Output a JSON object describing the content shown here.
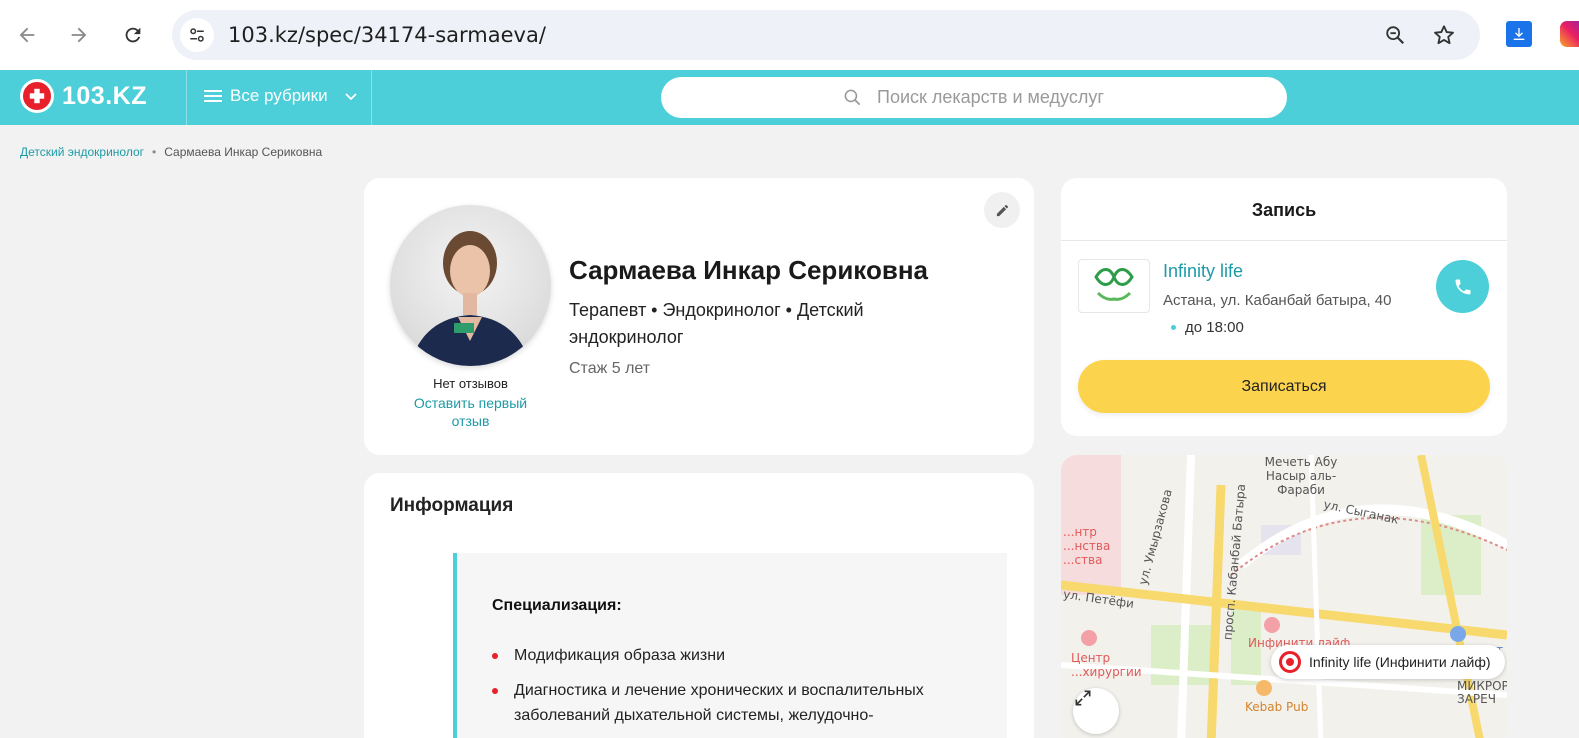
{
  "browser": {
    "url": "103.kz/spec/34174-sarmaeva/",
    "icons": [
      "back-icon",
      "forward-icon",
      "reload-icon",
      "site-info-icon",
      "zoom-icon",
      "star-icon",
      "download-extension-icon",
      "instagram-extension-icon"
    ]
  },
  "header": {
    "logo_text": "103.KZ",
    "rubrics_label": "Все рубрики",
    "search_placeholder": "Поиск лекарств и медуслуг",
    "brand_color": "#4ccfd9",
    "logo_color": "#e8202a"
  },
  "breadcrumb": {
    "parent": "Детский эндокринолог",
    "separator": "•",
    "current": "Сармаева Инкар Сериковна"
  },
  "profile": {
    "name": "Сармаева Инкар Сериковна",
    "specialties": "Терапевт • Эндокринолог • Детский эндокринолог",
    "experience": "Стаж 5 лет",
    "reviews_status": "Нет отзывов",
    "first_review_link": "Оставить первый отзыв"
  },
  "info": {
    "title": "Информация",
    "specialization_label": "Специализация:",
    "items": [
      "Модификация образа жизни",
      "Диагностика и лечение хронических и воспалительных заболеваний дыхательной системы, желудочно-"
    ]
  },
  "booking": {
    "title": "Запись",
    "clinic_name": "Infinity life",
    "clinic_address": "Астана, ул. Кабанбай батыра, 40",
    "hours": "до 18:00",
    "book_button": "Записаться",
    "button_color": "#fcd34d"
  },
  "map": {
    "pin_label": "Infinity life (Инфинити лайф)",
    "labels": {
      "mosque": "Мечеть Абу Насыр аль-Фараби",
      "street_syganak": "ул. Сыганак",
      "street_umyrzakov": "ул. Умырзакова",
      "street_kabanbay": "просп. Кабанбай Батыра",
      "street_petofi": "ул. Петёфи",
      "infiniti": "Инфинити лайф",
      "center_surgery": "Центр ...хирургии",
      "center_left": "...нтр ...нства ...ства",
      "kebab": "Kebab Pub",
      "komfort": "Комфорт",
      "mikror": "МИКРОР ЗАРЕЧ"
    }
  }
}
